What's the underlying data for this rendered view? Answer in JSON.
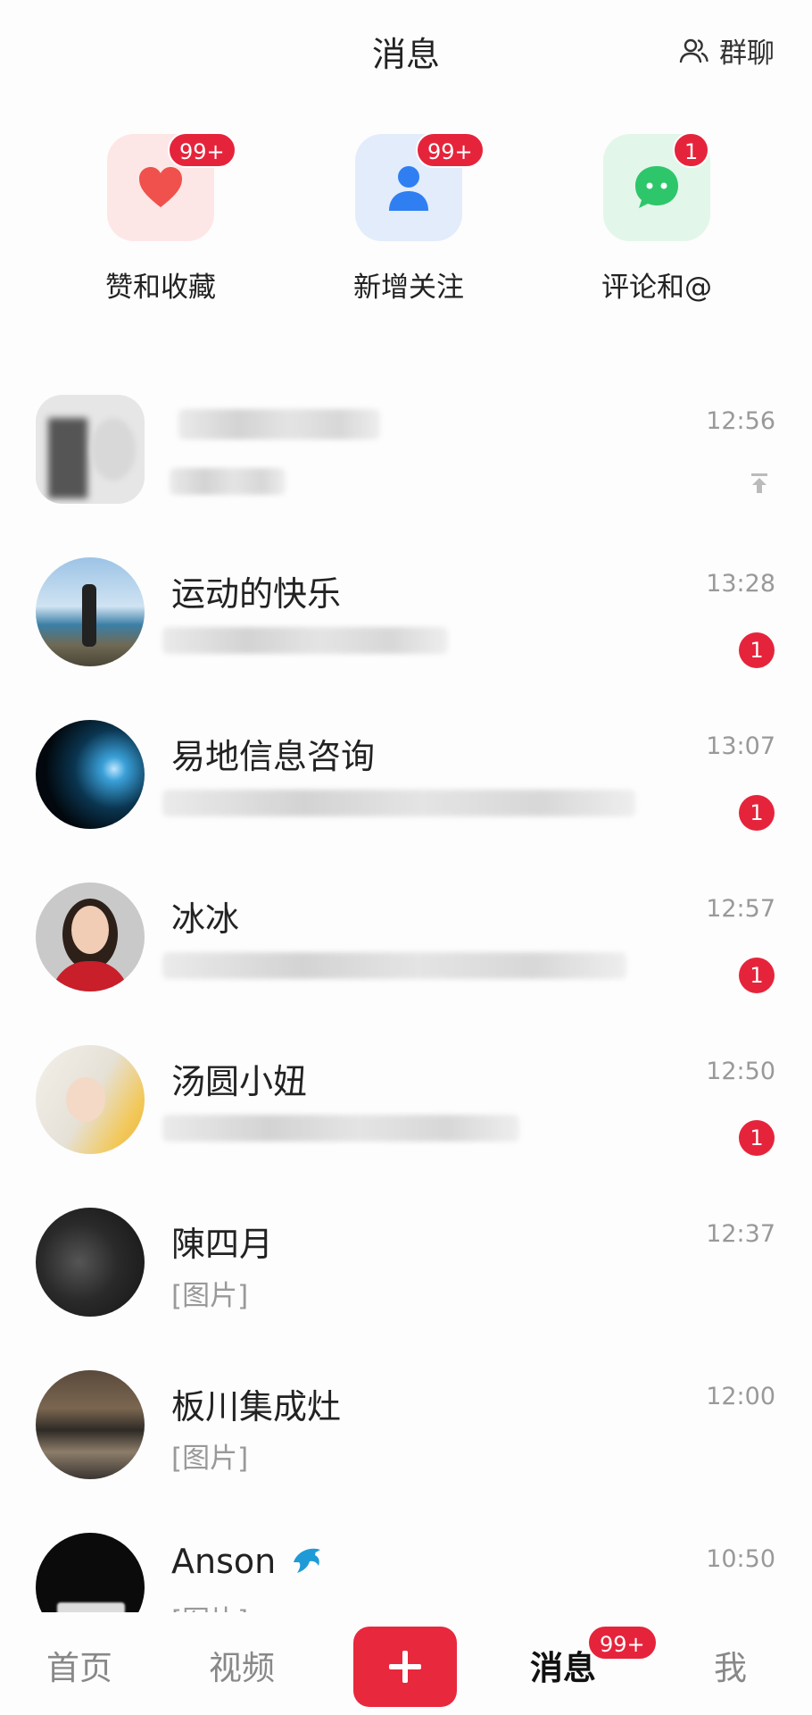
{
  "header": {
    "title": "消息",
    "group_chat_label": "群聊",
    "group_chat_icon": "people-icon"
  },
  "categories": [
    {
      "label": "赞和收藏",
      "badge": "99+",
      "icon": "heart-icon",
      "tile_color": "#fde7e6",
      "icon_color": "#f0514c"
    },
    {
      "label": "新增关注",
      "badge": "99+",
      "icon": "person-icon",
      "tile_color": "#e3ecfb",
      "icon_color": "#2f7ff2"
    },
    {
      "label": "评论和@",
      "badge": "1",
      "icon": "chat-bubble-icon",
      "tile_color": "#e3f6ea",
      "icon_color": "#2ec66a"
    }
  ],
  "messages": [
    {
      "name": "",
      "preview": "",
      "time": "12:56",
      "unread": "",
      "pinned": true
    },
    {
      "name": "运动的快乐",
      "preview": "",
      "time": "13:28",
      "unread": "1"
    },
    {
      "name": "易地信息咨询",
      "preview": "",
      "time": "13:07",
      "unread": "1"
    },
    {
      "name": "冰冰",
      "preview": "",
      "time": "12:57",
      "unread": "1"
    },
    {
      "name": "汤圆小妞",
      "preview": "",
      "time": "12:50",
      "unread": "1"
    },
    {
      "name": "陳四月",
      "preview": "[图片]",
      "time": "12:37",
      "unread": ""
    },
    {
      "name": "板川集成灶",
      "preview": "[图片]",
      "time": "12:00",
      "unread": ""
    },
    {
      "name": "Anson",
      "preview": "[图片]",
      "time": "10:50",
      "unread": ""
    }
  ],
  "nav": {
    "home": "首页",
    "video": "视频",
    "messages": "消息",
    "messages_badge": "99+",
    "me": "我",
    "accent": "#e8283d"
  }
}
